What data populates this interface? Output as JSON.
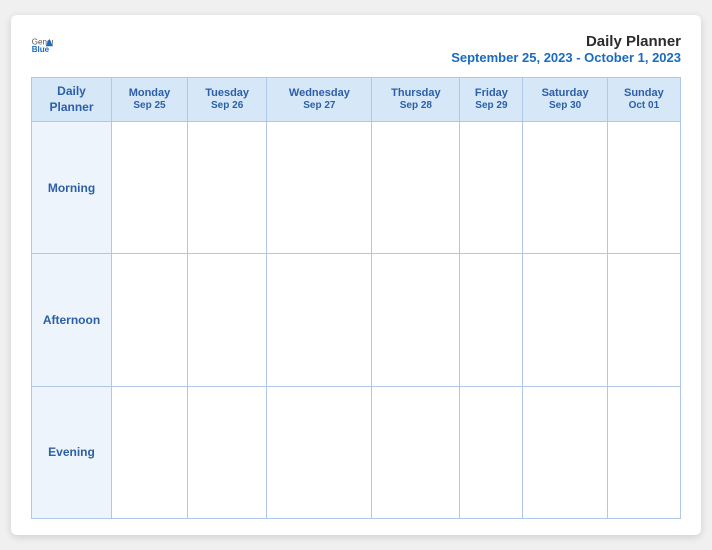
{
  "logo": {
    "general": "General",
    "blue": "Blue"
  },
  "title": {
    "main": "Daily Planner",
    "sub": "September 25, 2023 - October 1, 2023"
  },
  "columns": [
    {
      "day": "Daily",
      "day2": "Planner",
      "date": ""
    },
    {
      "day": "Monday",
      "day2": "",
      "date": "Sep 25"
    },
    {
      "day": "Tuesday",
      "day2": "",
      "date": "Sep 26"
    },
    {
      "day": "Wednesday",
      "day2": "",
      "date": "Sep 27"
    },
    {
      "day": "Thursday",
      "day2": "",
      "date": "Sep 28"
    },
    {
      "day": "Friday",
      "day2": "",
      "date": "Sep 29"
    },
    {
      "day": "Saturday",
      "day2": "",
      "date": "Sep 30"
    },
    {
      "day": "Sunday",
      "day2": "",
      "date": "Oct 01"
    }
  ],
  "rows": [
    {
      "label": "Morning"
    },
    {
      "label": "Afternoon"
    },
    {
      "label": "Evening"
    }
  ]
}
